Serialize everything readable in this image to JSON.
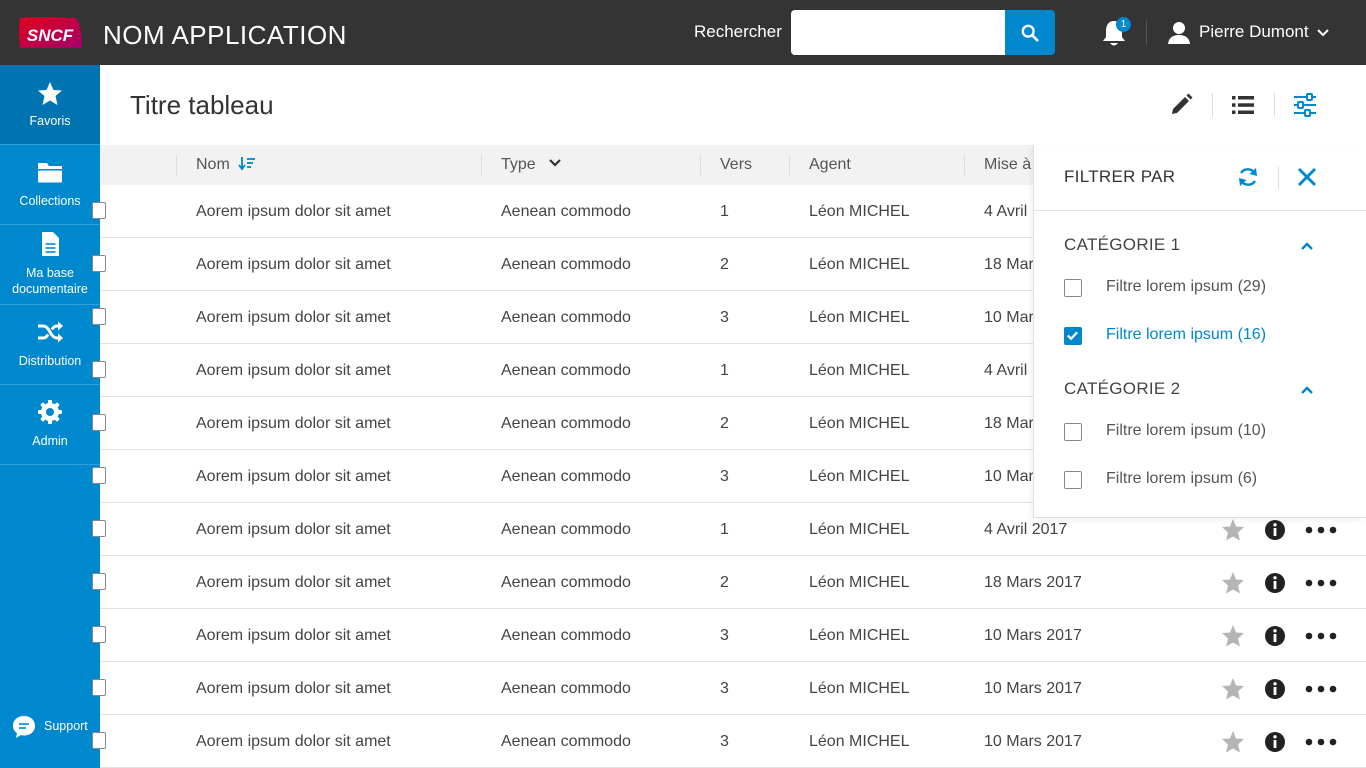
{
  "brand": {
    "logo_text": "SNCF",
    "accent": "#0088ce",
    "logo_red": "#c6114e"
  },
  "header": {
    "app_title": "NOM APPLICATION",
    "search_label": "Rechercher",
    "search_value": "",
    "search_icon": "search-icon",
    "notification_count": "1",
    "user_name": "Pierre Dumont"
  },
  "sidebar": {
    "items": [
      {
        "label": "Favoris",
        "icon": "star-icon",
        "active": true
      },
      {
        "label": "Collections",
        "icon": "folder-icon"
      },
      {
        "label": "Ma base documentaire",
        "icon": "document-icon"
      },
      {
        "label": "Distribution",
        "icon": "shuffle-icon"
      },
      {
        "label": "Admin",
        "icon": "gear-icon"
      }
    ],
    "support_label": "Support"
  },
  "page": {
    "title": "Titre tableau"
  },
  "table": {
    "columns": {
      "nom": "Nom",
      "type": "Type",
      "vers": "Vers",
      "agent": "Agent",
      "mise": "Mise à"
    },
    "rows": [
      {
        "nom": "Aorem ipsum dolor sit amet",
        "type": "Aenean commodo",
        "vers": "1",
        "agent": "Léon MICHEL",
        "date": "4 Avril"
      },
      {
        "nom": "Aorem ipsum dolor sit amet",
        "type": "Aenean commodo",
        "vers": "2",
        "agent": "Léon MICHEL",
        "date": "18 Mar"
      },
      {
        "nom": "Aorem ipsum dolor sit amet",
        "type": "Aenean commodo",
        "vers": "3",
        "agent": "Léon MICHEL",
        "date": "10 Mar"
      },
      {
        "nom": "Aorem ipsum dolor sit amet",
        "type": "Aenean commodo",
        "vers": "1",
        "agent": "Léon MICHEL",
        "date": "4 Avril"
      },
      {
        "nom": "Aorem ipsum dolor sit amet",
        "type": "Aenean commodo",
        "vers": "2",
        "agent": "Léon MICHEL",
        "date": "18 Mar"
      },
      {
        "nom": "Aorem ipsum dolor sit amet",
        "type": "Aenean commodo",
        "vers": "3",
        "agent": "Léon MICHEL",
        "date": "10 Mar"
      },
      {
        "nom": "Aorem ipsum dolor sit amet",
        "type": "Aenean commodo",
        "vers": "1",
        "agent": "Léon MICHEL",
        "date": "4 Avril 2017"
      },
      {
        "nom": "Aorem ipsum dolor sit amet",
        "type": "Aenean commodo",
        "vers": "2",
        "agent": "Léon MICHEL",
        "date": "18 Mars 2017"
      },
      {
        "nom": "Aorem ipsum dolor sit amet",
        "type": "Aenean commodo",
        "vers": "3",
        "agent": "Léon MICHEL",
        "date": "10 Mars 2017"
      },
      {
        "nom": "Aorem ipsum dolor sit amet",
        "type": "Aenean commodo",
        "vers": "3",
        "agent": "Léon MICHEL",
        "date": "10 Mars 2017"
      },
      {
        "nom": "Aorem ipsum dolor sit amet",
        "type": "Aenean commodo",
        "vers": "3",
        "agent": "Léon MICHEL",
        "date": "10 Mars 2017"
      }
    ]
  },
  "filter": {
    "title": "FILTRER PAR",
    "categories": [
      {
        "label": "CATÉGORIE 1",
        "options": [
          {
            "label": "Filtre lorem ipsum (29)",
            "checked": false
          },
          {
            "label": "Filtre lorem ipsum (16)",
            "checked": true
          }
        ]
      },
      {
        "label": "CATÉGORIE 2",
        "options": [
          {
            "label": "Filtre lorem ipsum (10)",
            "checked": false
          },
          {
            "label": "Filtre lorem ipsum (6)",
            "checked": false
          }
        ]
      }
    ]
  }
}
